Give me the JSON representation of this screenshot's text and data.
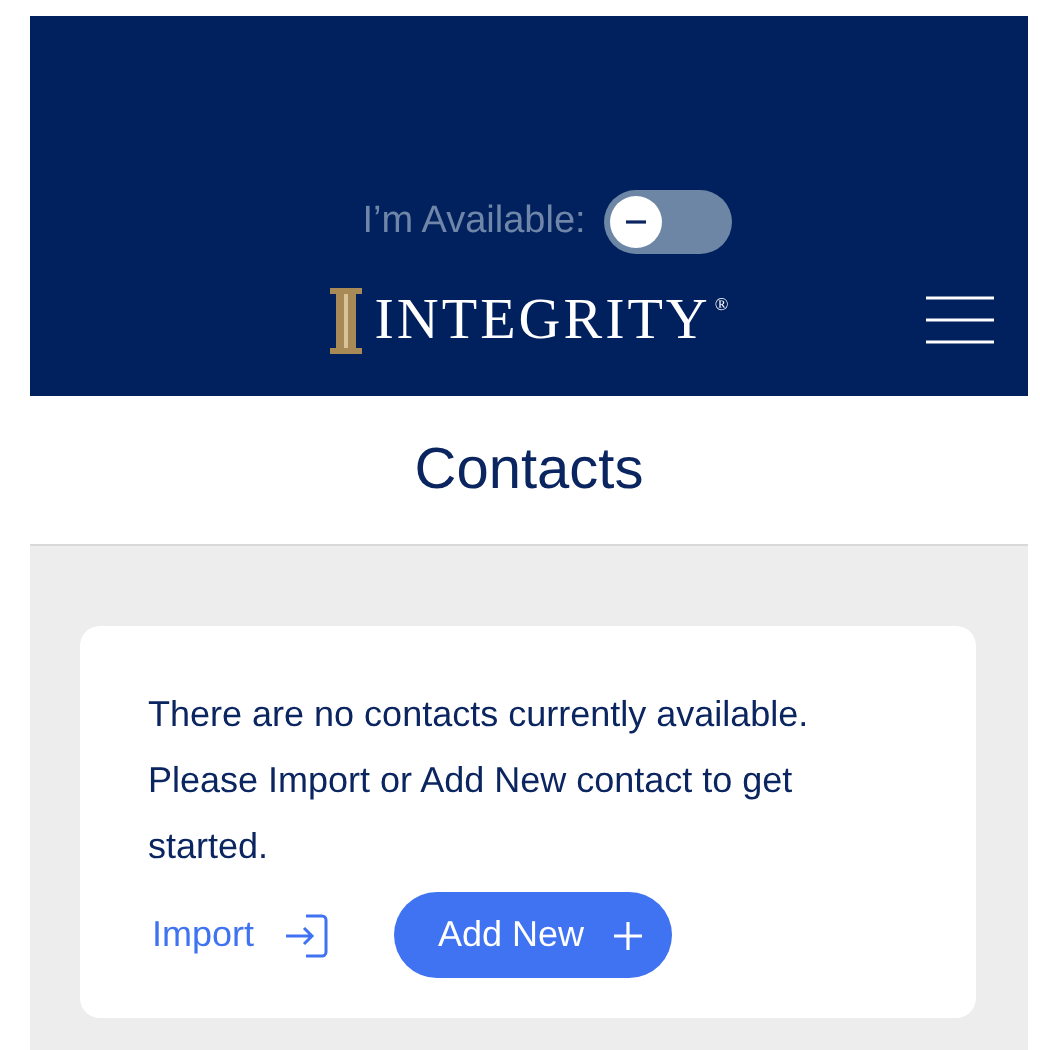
{
  "header": {
    "availability": {
      "label": "I’m Available:",
      "on": false
    },
    "logo": {
      "text": "INTEGRITY$^{®}$"
    }
  },
  "page_title": "Contacts",
  "empty_state": {
    "message": "There are no contacts currently available. Please Import or Add New contact to get started.",
    "actions": [
      {
        "kind": "link",
        "label": "Import"
      },
      {
        "kind": "primary",
        "label": "Add New"
      }
    ]
  }
}
